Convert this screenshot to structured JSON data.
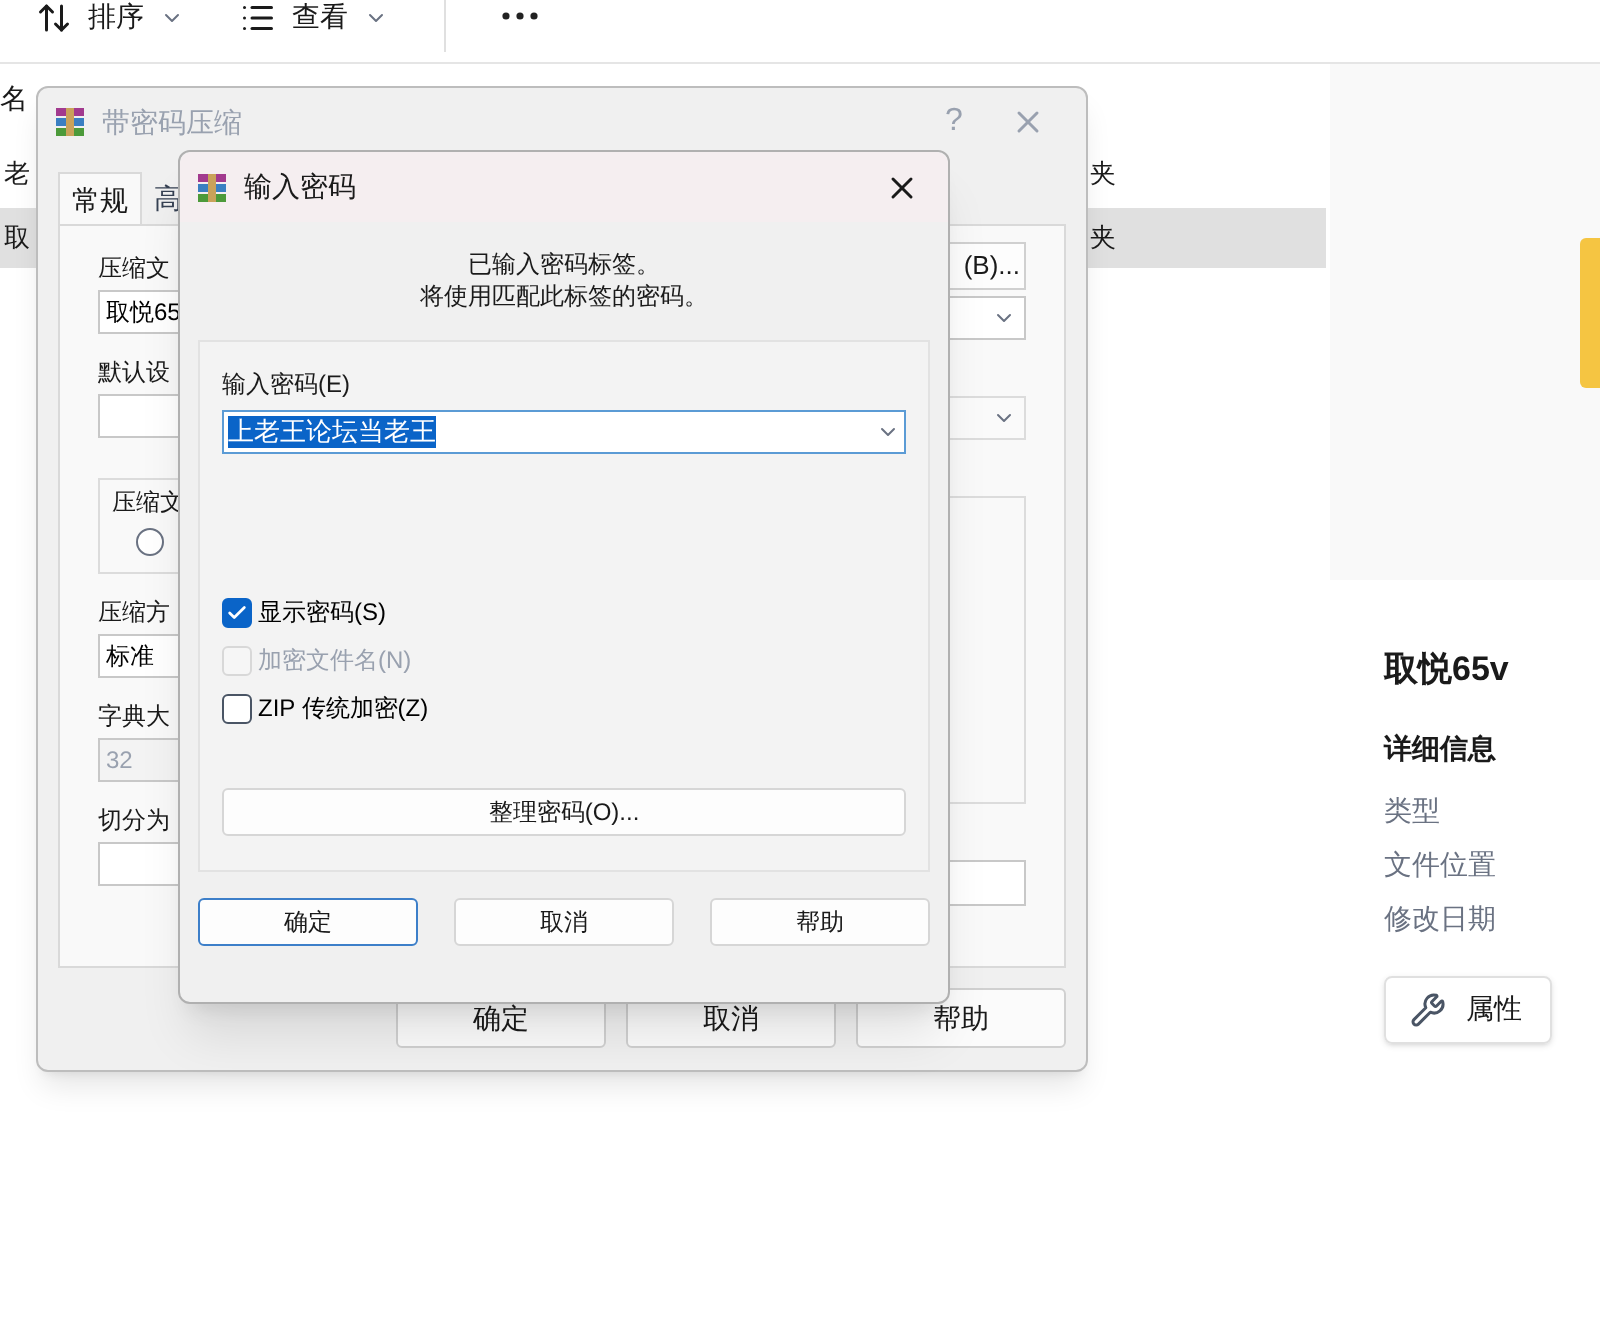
{
  "toolbar": {
    "items": [
      {
        "kind": "sort",
        "label": "排序"
      },
      {
        "kind": "view",
        "label": "查看"
      }
    ]
  },
  "file_list": {
    "column_1": "名",
    "rows": [
      {
        "column_1": "老",
        "column_3": "夹",
        "selected": false
      },
      {
        "column_1": "取",
        "column_3": "夹",
        "selected": true
      }
    ]
  },
  "compress_dialog": {
    "title": "带密码压缩",
    "help": "?",
    "tabs": [
      {
        "label": "常规",
        "selected": true
      },
      {
        "label": "高",
        "selected": false
      }
    ],
    "left_column": [
      {
        "kind": "label",
        "text": "压缩文"
      },
      {
        "kind": "field",
        "value": "取悦65"
      },
      {
        "kind": "label",
        "text": "默认设"
      },
      {
        "kind": "field"
      },
      {
        "kind": "group",
        "text": "压缩文",
        "checked": false
      },
      {
        "kind": "label",
        "text": "压缩方"
      },
      {
        "kind": "field",
        "value": "标准"
      },
      {
        "kind": "label",
        "text": "字典大"
      },
      {
        "kind": "field",
        "value": "32",
        "disabled": true
      },
      {
        "kind": "label",
        "text": "切分为"
      },
      {
        "kind": "field"
      }
    ],
    "browse_button": "(B)...",
    "buttons": [
      "确定",
      "取消",
      "帮助"
    ]
  },
  "password_dialog": {
    "title": "输入密码",
    "message": [
      "已输入密码标签。",
      "将使用匹配此标签的密码。"
    ],
    "password_label": "输入密码(E)",
    "password_value": "上老王论坛当老王",
    "options": [
      {
        "label": "显示密码(S)",
        "checked": true,
        "disabled": false
      },
      {
        "label": "加密文件名(N)",
        "checked": false,
        "disabled": true
      },
      {
        "label": "ZIP 传统加密(Z)",
        "checked": false,
        "disabled": false
      }
    ],
    "organize_button": "整理密码(O)...",
    "buttons": [
      {
        "label": "确定",
        "default": true
      },
      {
        "label": "取消",
        "default": false
      },
      {
        "label": "帮助",
        "default": false
      }
    ]
  },
  "details_pane": {
    "title": "取悦65v",
    "section": "详细信息",
    "properties": [
      "类型",
      "文件位置",
      "修改日期"
    ],
    "button": "属性"
  }
}
